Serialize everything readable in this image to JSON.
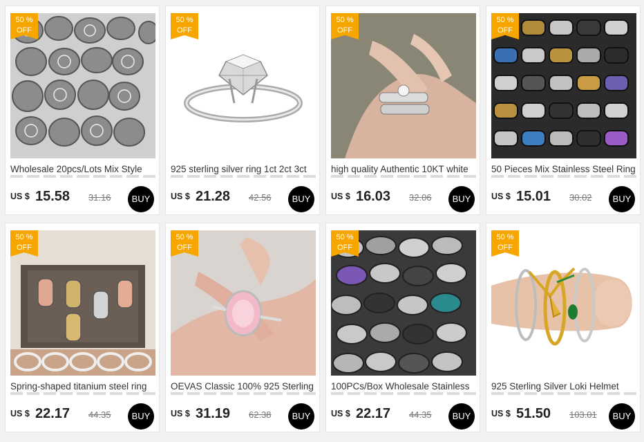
{
  "badge": {
    "line1": "50 %",
    "line2": "OFF"
  },
  "currency": "US $",
  "buy_label": "BUY",
  "colors": {
    "badge": "#f7a600",
    "buy_button": "#000000",
    "background": "#f2f2f2"
  },
  "products": [
    {
      "title": "Wholesale 20pcs/Lots Mix Style",
      "price": "15.58",
      "original_price": "31.16",
      "image": "silver-vintage-rings-tray"
    },
    {
      "title": "925 sterling silver ring 1ct 2ct 3ct",
      "price": "21.28",
      "original_price": "42.56",
      "image": "solitaire-diamond-ring"
    },
    {
      "title": "high quality Authentic 10KT white",
      "price": "16.03",
      "original_price": "32.06",
      "image": "hand-with-stacked-rings"
    },
    {
      "title": "50 Pieces Mix Stainless Steel Ring",
      "price": "15.01",
      "original_price": "30.02",
      "image": "steel-band-rings-tray"
    },
    {
      "title": "Spring-shaped titanium steel ring",
      "price": "22.17",
      "original_price": "44.35",
      "image": "titanium-rings-box"
    },
    {
      "title": "OEVAS Classic 100% 925 Sterling",
      "price": "31.19",
      "original_price": "62.38",
      "image": "pink-gem-ring-on-hand"
    },
    {
      "title": "100PCs/Box Wholesale Stainless",
      "price": "22.17",
      "original_price": "44.35",
      "image": "mixed-steel-rings-pile"
    },
    {
      "title": "925 Sterling Silver Loki Helmet",
      "price": "51.50",
      "original_price": "103.01",
      "image": "loki-helmet-ring-on-finger"
    }
  ]
}
